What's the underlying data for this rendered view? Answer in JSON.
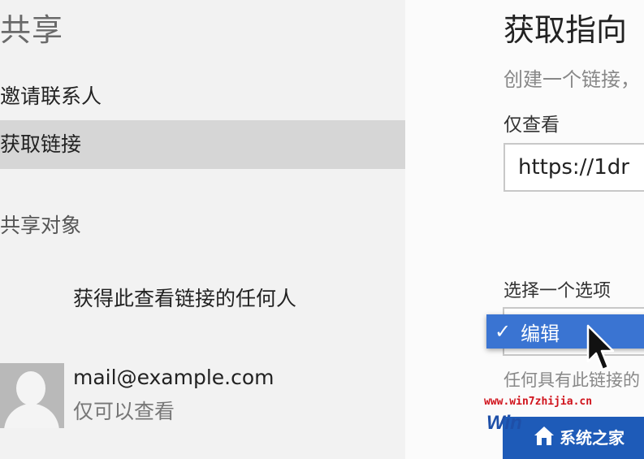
{
  "sidebar": {
    "title": "共享",
    "items": [
      {
        "label": "邀请联系人",
        "selected": false
      },
      {
        "label": "获取链接",
        "selected": true
      }
    ],
    "section_title": "共享对象",
    "anyone_label": "获得此查看链接的任何人",
    "contact": {
      "email": "mail@example.com",
      "permission": "仅可以查看"
    }
  },
  "main": {
    "title": "获取指向",
    "description": "创建一个链接，",
    "view_only_label": "仅查看",
    "link_value": "https://1dr",
    "select_label": "选择一个选项",
    "dropdown_selected": "编辑",
    "anyone_note": "任何具有此链接的"
  },
  "watermark": {
    "url": "www.win7zhijia.cn",
    "logo_letters": "Win",
    "site_name": "系统之家"
  },
  "colors": {
    "sidebar_bg": "#f2f2f2",
    "selected_bg": "#d6d6d6",
    "dropdown_highlight": "#3a74d2",
    "watermark_red": "#d0121b",
    "watermark_blue": "#1e5bb8"
  }
}
